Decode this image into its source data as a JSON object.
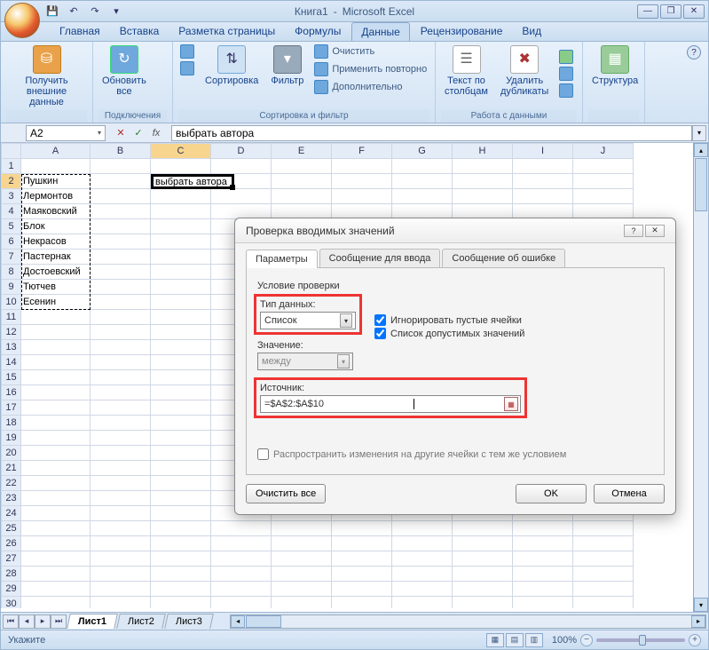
{
  "app": {
    "doc": "Книга1",
    "name": "Microsoft Excel"
  },
  "qat": {
    "save": "💾",
    "undo": "↶",
    "redo": "↷",
    "dd": "▾"
  },
  "win": {
    "min": "—",
    "max": "❐",
    "close": "✕"
  },
  "mdi": {
    "min": "—",
    "max": "❐",
    "close": "✕"
  },
  "tabs": {
    "home": "Главная",
    "insert": "Вставка",
    "layout": "Разметка страницы",
    "formulas": "Формулы",
    "data": "Данные",
    "review": "Рецензирование",
    "view": "Вид"
  },
  "ribbon": {
    "get_external": "Получить\nвнешние данные",
    "refresh": "Обновить\nвсе",
    "connections_lbl": "Подключения",
    "sort_az": "А↓Я",
    "sort_za": "Я↓А",
    "sort": "Сортировка",
    "filter": "Фильтр",
    "clear": "Очистить",
    "reapply": "Применить повторно",
    "advanced": "Дополнительно",
    "sort_filter_lbl": "Сортировка и фильтр",
    "text_to_cols": "Текст по\nстолбцам",
    "remove_dup": "Удалить\nдубликаты",
    "data_tools_lbl": "Работа с данными",
    "outline": "Структура",
    "help": "?"
  },
  "fbar": {
    "name": "A2",
    "cancel": "✕",
    "enter": "✓",
    "fx": "fx",
    "formula": "выбрать автора"
  },
  "cols": [
    "A",
    "B",
    "C",
    "D",
    "E",
    "F",
    "G",
    "H",
    "I",
    "J"
  ],
  "rows": [
    "1",
    "2",
    "3",
    "4",
    "5",
    "6",
    "7",
    "8",
    "9",
    "10",
    "11",
    "12",
    "13",
    "14",
    "15",
    "16",
    "17",
    "18",
    "19",
    "20",
    "21",
    "22",
    "23",
    "24",
    "25",
    "26",
    "27",
    "28",
    "29",
    "30"
  ],
  "cells": {
    "a2": "Пушкин",
    "a3": "Лермонтов",
    "a4": "Маяковский",
    "a5": "Блок",
    "a6": "Некрасов",
    "a7": "Пастернак",
    "a8": "Достоевский",
    "a9": "Тютчев",
    "a10": "Есенин",
    "c2": "выбрать автора"
  },
  "dialog": {
    "title": "Проверка вводимых значений",
    "help": "?",
    "close": "✕",
    "tab_params": "Параметры",
    "tab_input": "Сообщение для ввода",
    "tab_error": "Сообщение об ошибке",
    "cond_title": "Условие проверки",
    "type_label": "Тип данных:",
    "type_value": "Список",
    "value_label": "Значение:",
    "value_value": "между",
    "source_label": "Источник:",
    "source_value": "=$A$2:$A$10",
    "ignore_blank": "Игнорировать пустые ячейки",
    "dropdown_list": "Список допустимых значений",
    "propagate": "Распространить изменения на другие ячейки с тем же условием",
    "clear_all": "Очистить все",
    "ok": "OK",
    "cancel": "Отмена"
  },
  "sheets": {
    "s1": "Лист1",
    "s2": "Лист2",
    "s3": "Лист3"
  },
  "status": {
    "mode": "Укажите",
    "zoom": "100%"
  }
}
